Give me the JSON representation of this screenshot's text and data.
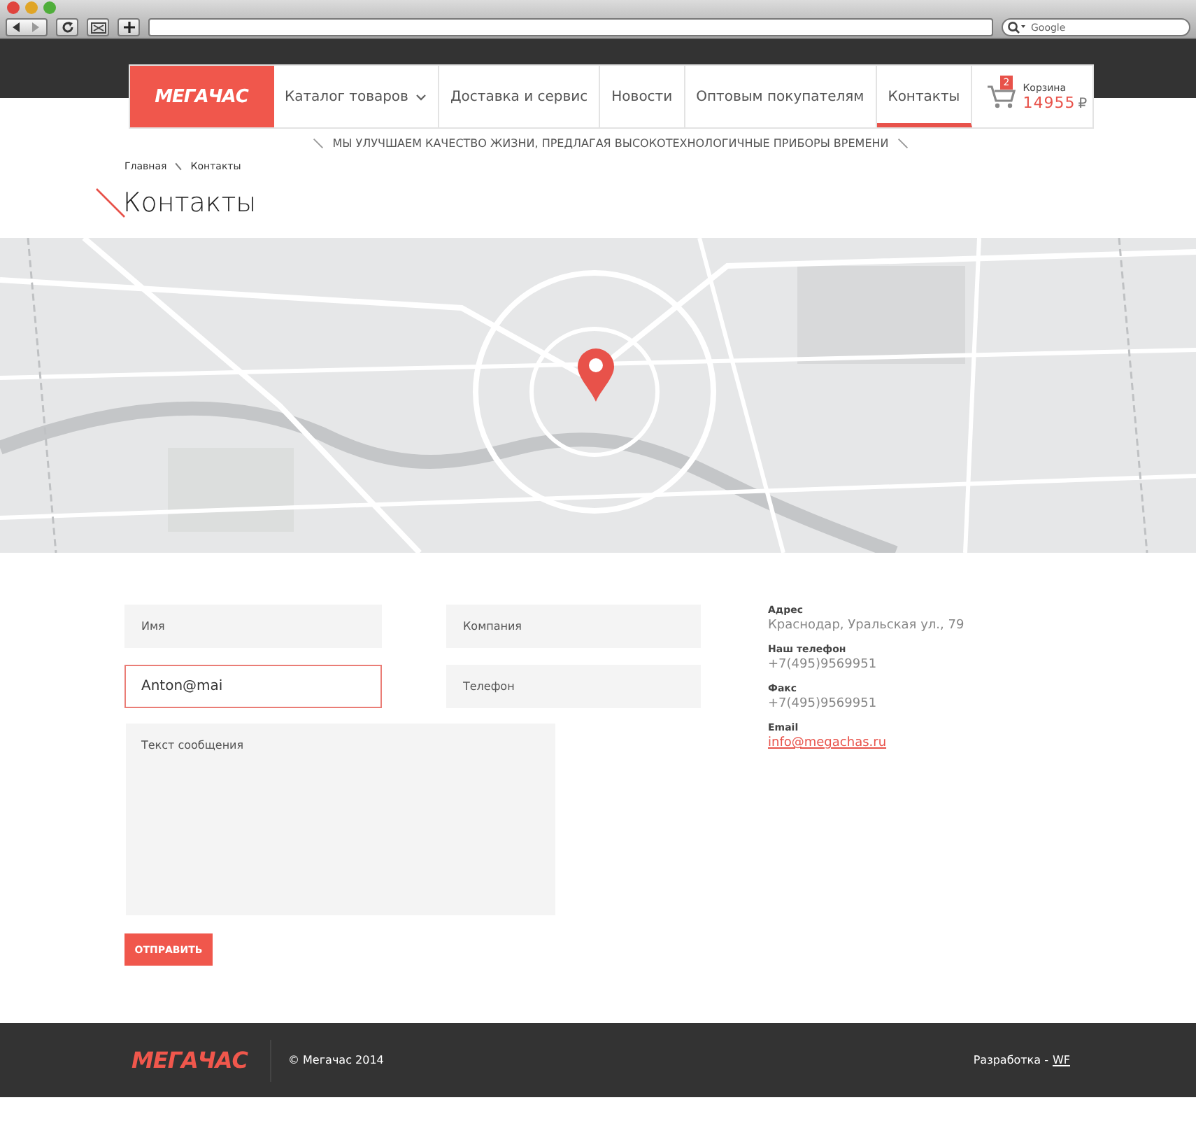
{
  "browser": {
    "search": {
      "placeholder": "Google"
    }
  },
  "header": {
    "logo": "МЕГАЧАС",
    "nav": [
      {
        "label": "Каталог товаров",
        "has_dropdown": true,
        "selected": false
      },
      {
        "label": "Доставка и сервис",
        "has_dropdown": false,
        "selected": false
      },
      {
        "label": "Новости",
        "has_dropdown": false,
        "selected": false
      },
      {
        "label": "Оптовым покупателям",
        "has_dropdown": false,
        "selected": false
      },
      {
        "label": "Контакты",
        "has_dropdown": false,
        "selected": true
      }
    ],
    "cart": {
      "count": "2",
      "label": "Корзина",
      "amount": "14955",
      "currency": "₽"
    },
    "tagline": "МЫ УЛУЧШАЕМ КАЧЕСТВО ЖИЗНИ, ПРЕДЛАГАЯ ВЫСОКОТЕХНОЛОГИЧНЫЕ ПРИБОРЫ ВРЕМЕНИ"
  },
  "breadcrumbs": [
    "Главная",
    "Контакты"
  ],
  "page_title": "Контакты",
  "form": {
    "fields": [
      {
        "placeholder": "Имя",
        "focused": false
      },
      {
        "placeholder": "Компания",
        "focused": false
      },
      {
        "value": "Anton@mai",
        "focused": true
      },
      {
        "placeholder": "Телефон",
        "focused": false
      }
    ],
    "message": {
      "placeholder": "Текст сообщения"
    },
    "submit": "ОТПРАВИТЬ"
  },
  "contacts": [
    {
      "label": "Адрес",
      "value": "Краснодар, Уральская ул., 79",
      "kind": "text"
    },
    {
      "label": "Наш телефон",
      "value": "+7(495)9569951",
      "kind": "text"
    },
    {
      "label": "Факс",
      "value": "+7(495)9569951",
      "kind": "text"
    },
    {
      "label": "Email",
      "value": "info@megachas.ru",
      "kind": "link"
    }
  ],
  "footer": {
    "logo": "МЕГАЧАС",
    "copyright": "© Мегачас 2014",
    "credit": "Разработка -",
    "credit_link": "WF"
  }
}
